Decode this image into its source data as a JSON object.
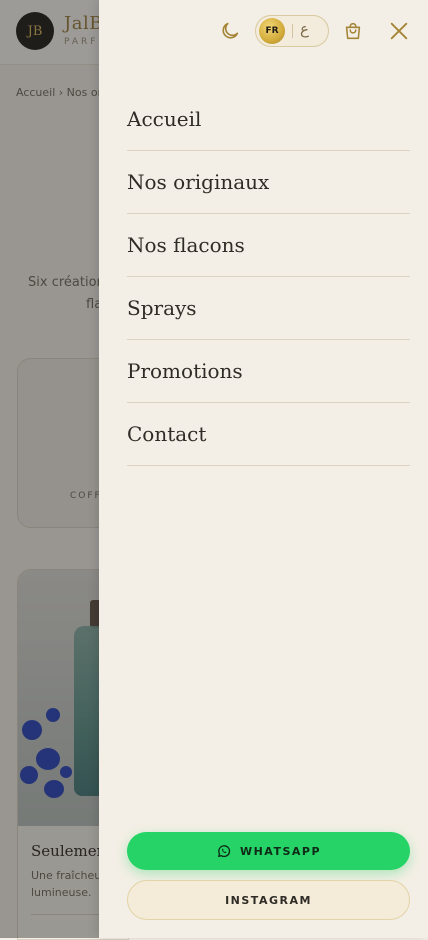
{
  "background": {
    "brand": {
      "logo_text": "JB",
      "name": "JalB",
      "subtitle": "PARF"
    },
    "breadcrumb": "Accueil › Nos or",
    "intro": {
      "line1": "Six création",
      "line2": "fla"
    },
    "card1": {
      "category": "COFF"
    },
    "card2": {
      "title": "Seulemen",
      "description": "Une fraîcheur lumineuse."
    }
  },
  "drawer": {
    "language": {
      "active": "FR",
      "alternate": "ع"
    },
    "menu": [
      "Accueil",
      "Nos originaux",
      "Nos flacons",
      "Sprays",
      "Promotions",
      "Contact"
    ],
    "whatsapp_label": "WHATSAPP",
    "instagram_label": "INSTAGRAM"
  },
  "icons": {
    "theme": "moon-icon",
    "cart": "shopping-bag-icon",
    "close": "close-icon",
    "whatsapp": "whatsapp-icon"
  },
  "colors": {
    "accent_gold": "#b0903f",
    "whatsapp_green": "#25d366",
    "drawer_bg": "#f4efe6"
  }
}
